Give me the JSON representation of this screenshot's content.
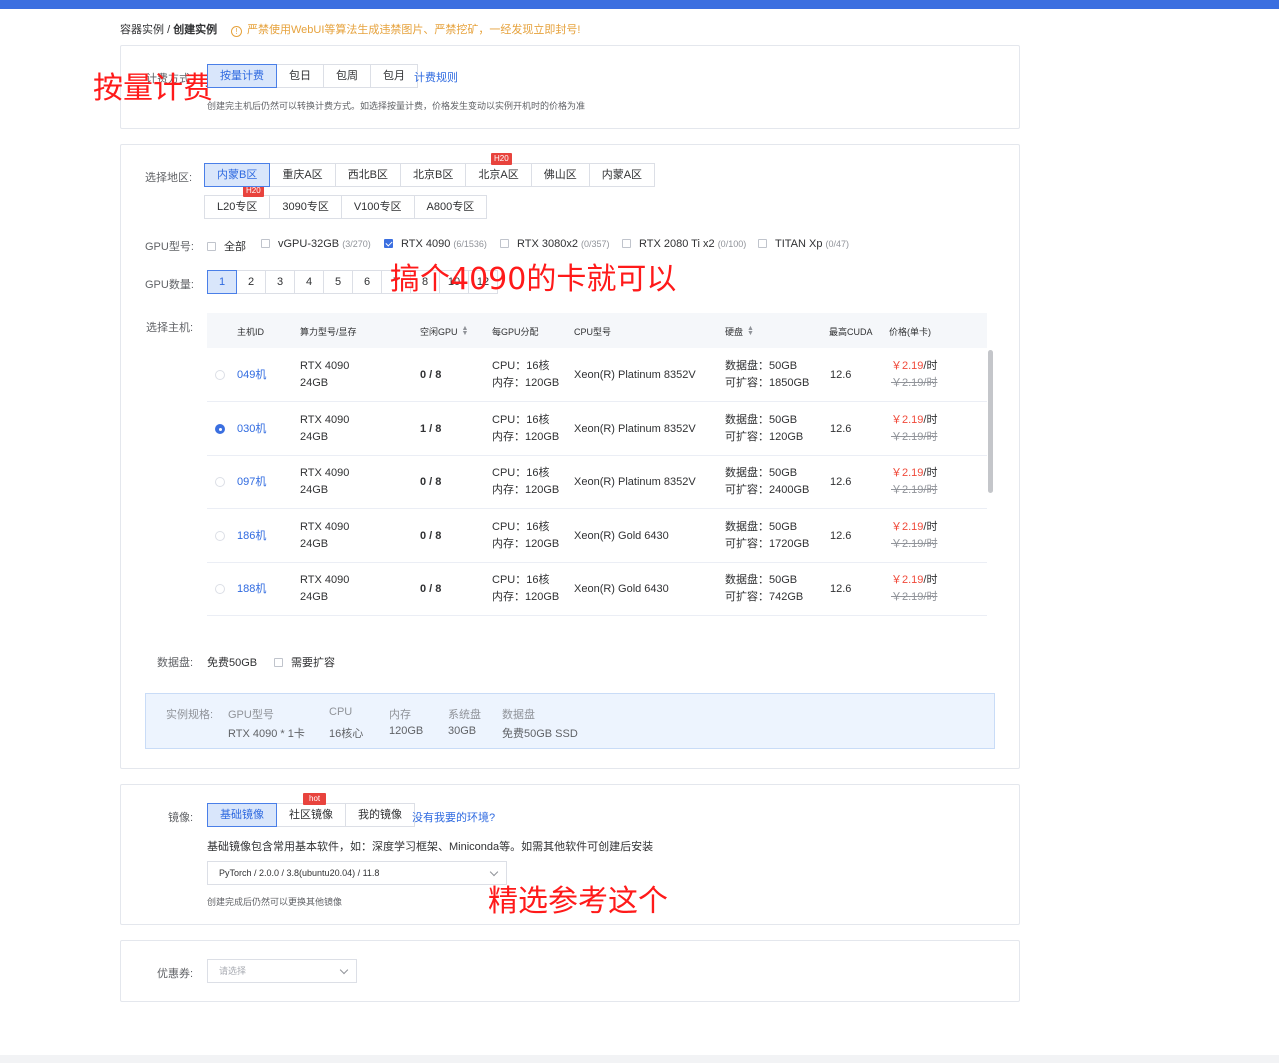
{
  "breadcrumb": {
    "parent": "容器实例",
    "separator": "/",
    "current": "创建实例"
  },
  "warning": {
    "icon": "warning-circle-icon",
    "text": "严禁使用WebUI等算法生成违禁图片、严禁挖矿，一经发现立即封号!"
  },
  "billing": {
    "label": "计费方式",
    "options": [
      "按量计费",
      "包日",
      "包周",
      "包月"
    ],
    "selected": "按量计费",
    "rules_link": "计费规则",
    "hint": "创建完主机后仍然可以转换计费方式。如选择按量计费，价格发生变动以实例开机时的价格为准"
  },
  "region": {
    "label": "选择地区:",
    "row1": [
      "内蒙B区",
      "重庆A区",
      "西北B区",
      "北京B区",
      "北京A区",
      "佛山区",
      "内蒙A区"
    ],
    "row2": [
      "L20专区",
      "3090专区",
      "V100专区",
      "A800专区"
    ],
    "selected": "内蒙B区",
    "badge_beijing_a": "H20",
    "badge_l20": "H20"
  },
  "gpu_model": {
    "label": "GPU型号:",
    "options": [
      {
        "name": "全部",
        "count": "",
        "checked": false
      },
      {
        "name": "vGPU-32GB",
        "count": "(3/270)",
        "checked": false
      },
      {
        "name": "RTX 4090",
        "count": "(6/1536)",
        "checked": true
      },
      {
        "name": "RTX 3080x2",
        "count": "(0/357)",
        "checked": false
      },
      {
        "name": "RTX 2080 Ti x2",
        "count": "(0/100)",
        "checked": false
      },
      {
        "name": "TITAN Xp",
        "count": "(0/47)",
        "checked": false
      }
    ]
  },
  "gpu_count": {
    "label": "GPU数量:",
    "options": [
      "1",
      "2",
      "3",
      "4",
      "5",
      "6",
      "7",
      "8",
      "10",
      "12"
    ],
    "selected": "1"
  },
  "host": {
    "label": "选择主机:",
    "columns": [
      "主机ID",
      "算力型号/显存",
      "空闲GPU",
      "每GPU分配",
      "CPU型号",
      "硬盘",
      "最高CUDA",
      "价格(单卡)"
    ],
    "rows": [
      {
        "id": "049机",
        "model": "RTX 4090",
        "vram": "24GB",
        "free": "0 / 8",
        "cpu": "CPU：16核",
        "mem": "内存：120GB",
        "cpu_model": "Xeon(R) Platinum 8352V",
        "disk": "数据盘：50GB",
        "expand": "可扩容：1850GB",
        "cuda": "12.6",
        "price": "￥2.19",
        "price_unit": "/时",
        "old_price": "￥2.19/时",
        "selected": false
      },
      {
        "id": "030机",
        "model": "RTX 4090",
        "vram": "24GB",
        "free": "1 / 8",
        "cpu": "CPU：16核",
        "mem": "内存：120GB",
        "cpu_model": "Xeon(R) Platinum 8352V",
        "disk": "数据盘：50GB",
        "expand": "可扩容：120GB",
        "cuda": "12.6",
        "price": "￥2.19",
        "price_unit": "/时",
        "old_price": "￥2.19/时",
        "selected": true
      },
      {
        "id": "097机",
        "model": "RTX 4090",
        "vram": "24GB",
        "free": "0 / 8",
        "cpu": "CPU：16核",
        "mem": "内存：120GB",
        "cpu_model": "Xeon(R) Platinum 8352V",
        "disk": "数据盘：50GB",
        "expand": "可扩容：2400GB",
        "cuda": "12.6",
        "price": "￥2.19",
        "price_unit": "/时",
        "old_price": "￥2.19/时",
        "selected": false
      },
      {
        "id": "186机",
        "model": "RTX 4090",
        "vram": "24GB",
        "free": "0 / 8",
        "cpu": "CPU：16核",
        "mem": "内存：120GB",
        "cpu_model": "Xeon(R) Gold 6430",
        "disk": "数据盘：50GB",
        "expand": "可扩容：1720GB",
        "cuda": "12.6",
        "price": "￥2.19",
        "price_unit": "/时",
        "old_price": "￥2.19/时",
        "selected": false
      },
      {
        "id": "188机",
        "model": "RTX 4090",
        "vram": "24GB",
        "free": "0 / 8",
        "cpu": "CPU：16核",
        "mem": "内存：120GB",
        "cpu_model": "Xeon(R) Gold 6430",
        "disk": "数据盘：50GB",
        "expand": "可扩容：742GB",
        "cuda": "12.6",
        "price": "￥2.19",
        "price_unit": "/时",
        "old_price": "￥2.19/时",
        "selected": false
      }
    ]
  },
  "data_disk": {
    "label": "数据盘:",
    "free": "免费50GB",
    "expand_label": "需要扩容"
  },
  "spec": {
    "label": "实例规格:",
    "gpu_k": "GPU型号",
    "gpu_v": "RTX 4090 * 1卡",
    "cpu_k": "CPU",
    "cpu_v": "16核心",
    "mem_k": "内存",
    "mem_v": "120GB",
    "sys_k": "系统盘",
    "sys_v": "30GB",
    "disk_k": "数据盘",
    "disk_v": "免费50GB SSD"
  },
  "image": {
    "label": "镜像:",
    "tabs": [
      "基础镜像",
      "社区镜像",
      "我的镜像"
    ],
    "selected": "基础镜像",
    "hot_badge": "hot",
    "missing_link": "没有我要的环境?",
    "desc": "基础镜像包含常用基本软件，如：深度学习框架、Miniconda等。如需其他软件可创建后安装",
    "selected_value": "PyTorch / 2.0.0 / 3.8(ubuntu20.04) / 11.8",
    "hint": "创建完成后仍然可以更换其他镜像"
  },
  "coupon": {
    "label": "优惠券:",
    "placeholder": "请选择"
  },
  "annotations": {
    "billing": "按量计费",
    "gpu": "搞个4090的卡就可以",
    "image": "精选参考这个"
  },
  "colors": {
    "accent": "#3b6fe0",
    "price": "#f04a3a",
    "warning": "#e6a23c",
    "annotation": "#ff1a1a"
  }
}
